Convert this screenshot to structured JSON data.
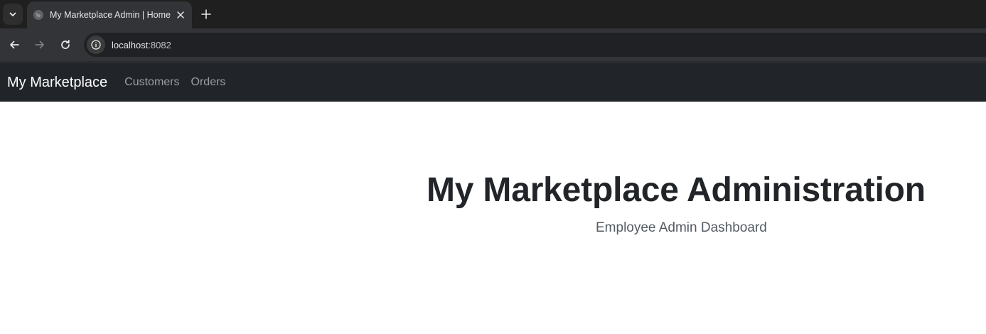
{
  "browser": {
    "tab": {
      "title": "My Marketplace Admin | Home"
    },
    "address_bar": {
      "host": "localhost",
      "port": ":8082"
    },
    "icons": {
      "tab_search": "chevron-down-icon",
      "favicon": "globe-icon",
      "close": "close-icon",
      "new_tab": "plus-icon",
      "back": "arrow-left-icon",
      "forward": "arrow-right-icon",
      "reload": "reload-icon",
      "site_info": "info-icon"
    }
  },
  "navbar": {
    "brand": "My Marketplace",
    "links": [
      "Customers",
      "Orders"
    ]
  },
  "hero": {
    "title": "My Marketplace Administration",
    "subtitle": "Employee Admin Dashboard"
  },
  "colors": {
    "navbar_bg": "#212529",
    "text_dark": "#212529",
    "text_muted": "#545b62"
  }
}
